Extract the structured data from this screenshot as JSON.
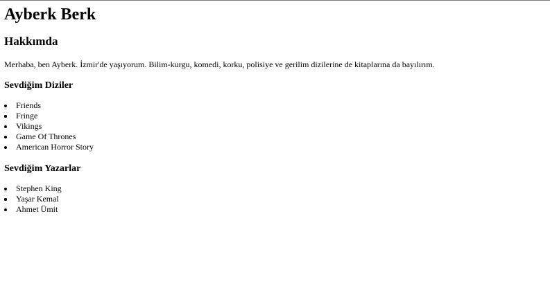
{
  "page": {
    "title": "Ayberk Berk",
    "about_heading": "Hakkımda",
    "about_text": "Merhaba, ben Ayberk. İzmir'de yaşıyorum. Bilim-kurgu, komedi, korku, polisiye ve gerilim dizilerine de kitaplarına da bayılırım."
  },
  "series": {
    "heading": "Sevdiğim Diziler",
    "items": [
      {
        "label": "Friends"
      },
      {
        "label": "Fringe"
      },
      {
        "label": "Vikings"
      },
      {
        "label": "Game Of Thrones"
      },
      {
        "label": "American Horror Story"
      }
    ]
  },
  "authors": {
    "heading": "Sevdiğim Yazarlar",
    "items": [
      {
        "label": "Stephen King"
      },
      {
        "label": "Yaşar Kemal"
      },
      {
        "label": "Ahmet Ümit"
      }
    ]
  }
}
